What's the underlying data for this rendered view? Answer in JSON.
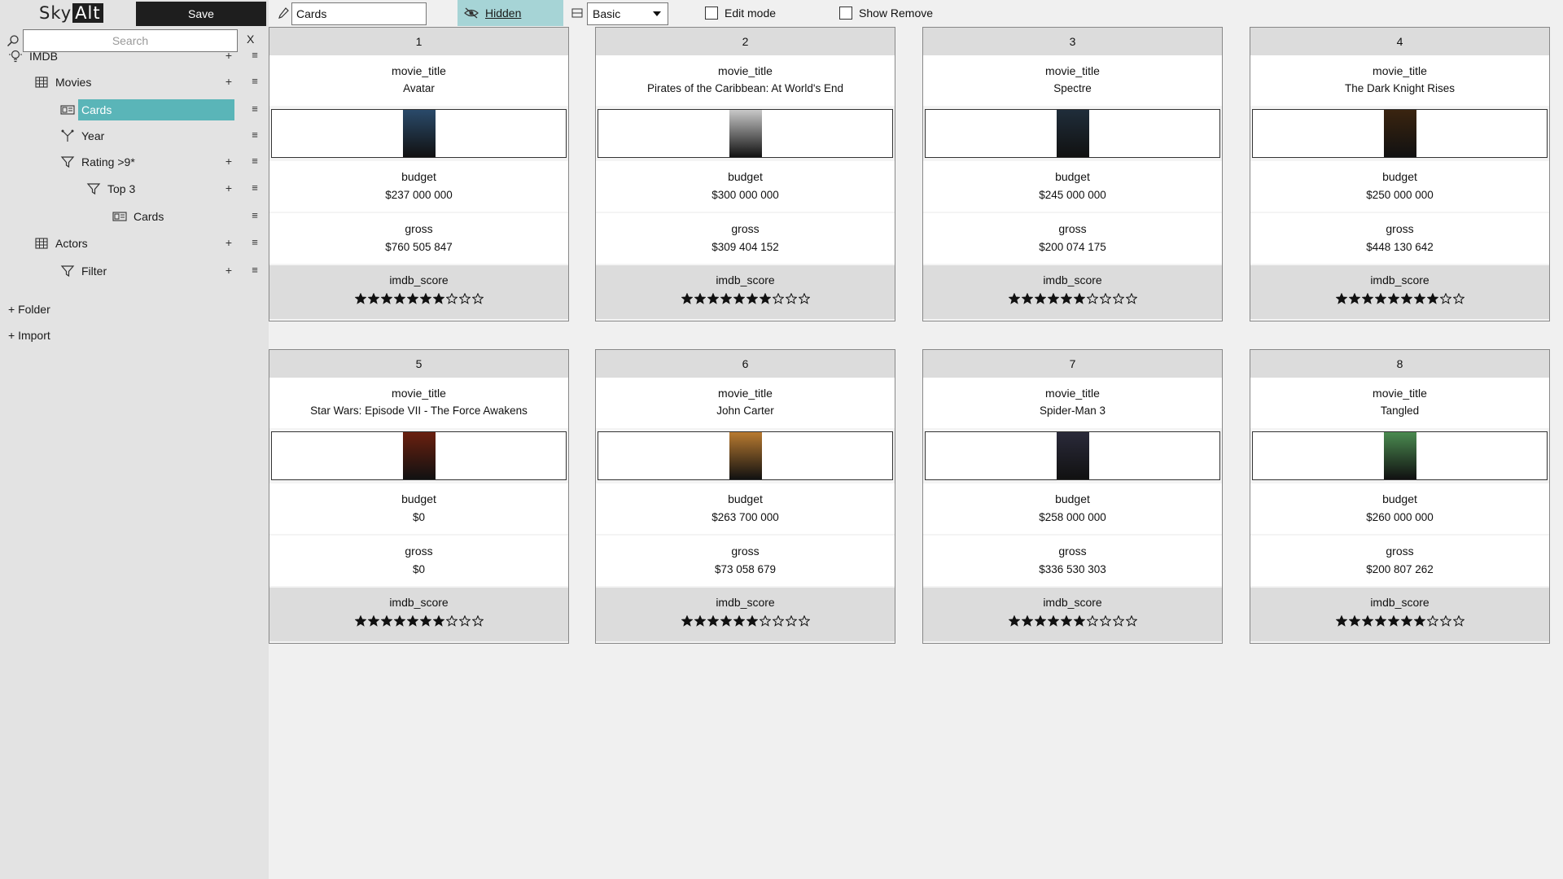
{
  "app": {
    "logo_left": "Sky",
    "logo_right": "Alt",
    "save_label": "Save"
  },
  "sidebar": {
    "search_placeholder": "Search",
    "search_clear": "X",
    "tree": [
      {
        "label": "IMDB",
        "icon": "lightbulb-icon",
        "has_plus": true
      },
      {
        "label": "Movies",
        "icon": "table-icon",
        "has_plus": true
      },
      {
        "label": "Cards",
        "icon": "cards-icon",
        "has_plus": false,
        "selected": true
      },
      {
        "label": "Year",
        "icon": "group-icon",
        "has_plus": false
      },
      {
        "label": "Rating >9*",
        "icon": "filter-icon",
        "has_plus": true
      },
      {
        "label": "Top 3",
        "icon": "filter-icon",
        "has_plus": true
      },
      {
        "label": "Cards",
        "icon": "cards-icon",
        "has_plus": false
      },
      {
        "label": "Actors",
        "icon": "table-icon",
        "has_plus": true
      },
      {
        "label": "Filter",
        "icon": "filter-icon",
        "has_plus": true
      }
    ],
    "tree_plus": "+",
    "tree_menu": "≡",
    "add_folder": "+ Folder",
    "add_import": "+ Import"
  },
  "toolbar": {
    "view_name": "Cards",
    "hidden_label": "Hidden",
    "layout_value": "Basic",
    "edit_mode_label": "Edit mode",
    "show_remove_label": "Show Remove"
  },
  "field_labels": {
    "title": "movie_title",
    "budget": "budget",
    "gross": "gross",
    "score": "imdb_score"
  },
  "cards": [
    {
      "index": "1",
      "title": "Avatar",
      "budget": "$237 000 000",
      "gross": "$760 505 847",
      "stars_filled": 7,
      "stars_total": 10,
      "poster_color": "#2a4a6a"
    },
    {
      "index": "2",
      "title": "Pirates of the Caribbean: At World's End",
      "budget": "$300 000 000",
      "gross": "$309 404 152",
      "stars_filled": 7,
      "stars_total": 10,
      "poster_color": "#c8c8c8"
    },
    {
      "index": "3",
      "title": "Spectre",
      "budget": "$245 000 000",
      "gross": "$200 074 175",
      "stars_filled": 6,
      "stars_total": 10,
      "poster_color": "#1f2d3a"
    },
    {
      "index": "4",
      "title": "The Dark Knight Rises",
      "budget": "$250 000 000",
      "gross": "$448 130 642",
      "stars_filled": 8,
      "stars_total": 10,
      "poster_color": "#3a2410"
    },
    {
      "index": "5",
      "title": "Star Wars: Episode VII - The Force Awakens",
      "budget": "$0",
      "gross": "$0",
      "stars_filled": 7,
      "stars_total": 10,
      "poster_color": "#6a2010"
    },
    {
      "index": "6",
      "title": "John Carter",
      "budget": "$263 700 000",
      "gross": "$73 058 679",
      "stars_filled": 6,
      "stars_total": 10,
      "poster_color": "#b87a30"
    },
    {
      "index": "7",
      "title": "Spider-Man 3",
      "budget": "$258 000 000",
      "gross": "$336 530 303",
      "stars_filled": 6,
      "stars_total": 10,
      "poster_color": "#2a2a3a"
    },
    {
      "index": "8",
      "title": "Tangled",
      "budget": "$260 000 000",
      "gross": "$200 807 262",
      "stars_filled": 7,
      "stars_total": 10,
      "poster_color": "#4a8a50"
    }
  ]
}
